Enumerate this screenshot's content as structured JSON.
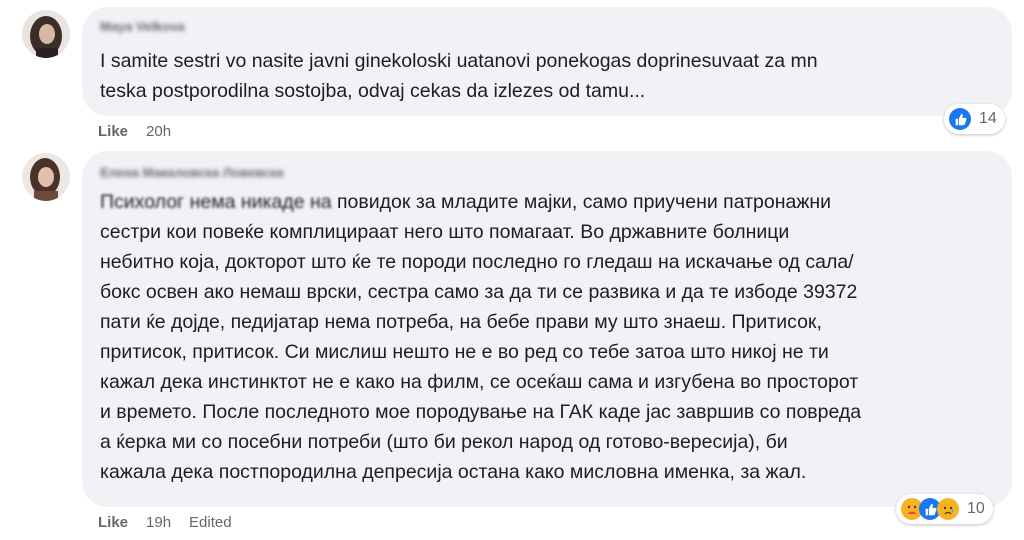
{
  "comments": [
    {
      "author": "Maya Velkova",
      "text": "I samite sestri vo nasite javni ginekoloski uatanovi ponekogas doprinesuvaat za mn\nteska postporodilna sostojba, odvaj cekas da izlezes od tamu...",
      "like_label": "Like",
      "time": "20h",
      "reaction_count": "14",
      "reactions": [
        "like-icon"
      ]
    },
    {
      "author": "Елена Макаловска Ловевска",
      "text_blurred_start": "Психолог нема никаде на ",
      "text": "повидок за младите мајки, само приучени патронажни\nсестри кои повеќе комплицираат него што помагаат. Во државните болници\nнебитно која, докторот што ќе те породи последно го гледаш на искачање од сала/\nбокс освен ако немаш врски, сестра само за да ти се развика и да те избоде 39372\nпати ќе дојде, педијатар нема потреба, на бебе прави му што знаеш. Притисок,\nпритисок, притисок. Си мислиш нешто не е во ред со тебе затоа што никој не ти\nкажал дека инстинктот не е како на филм, се осеќаш сама и изгубена во просторот\nи времето. После последното мое породување на ГАК каде јас завршив со повреда\nа ќерка ми со посебни потреби (што би рекол народ од готово-вересија), би\nкажала дека постпородилна депресија остана како мисловна именка, за жал.",
      "like_label": "Like",
      "time": "19h",
      "edited_label": "Edited",
      "reaction_count": "10",
      "reactions": [
        "care-icon",
        "like-icon",
        "sad-icon"
      ]
    }
  ]
}
